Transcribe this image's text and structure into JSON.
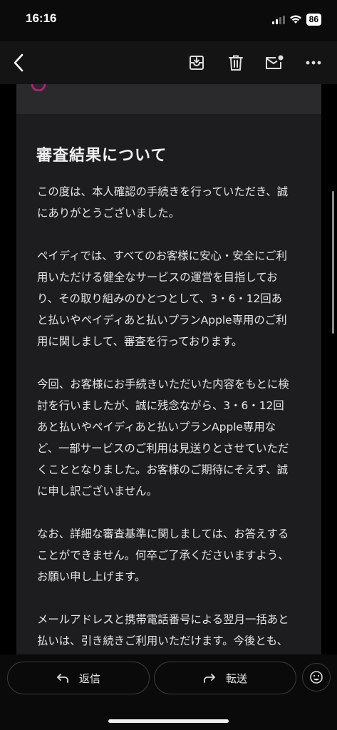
{
  "status": {
    "time": "16:16",
    "battery": "86"
  },
  "toolbar": {
    "back_icon": "chevron-left-icon",
    "archive_icon": "archive-icon",
    "trash_icon": "trash-icon",
    "mark_unread_icon": "mail-unread-icon",
    "more_icon": "more-horizontal-icon"
  },
  "email": {
    "title": "審査結果について",
    "paragraphs": [
      "この度は、本人確認の手続きを行っていただき、誠\nにありがとうございました。",
      "ペイディでは、すべてのお客様に安心・安全にご利\n用いただける健全なサービスの運営を目指してお\nり、その取り組みのひとつとして、3・6・12回あ\nと払いやペイディあと払いプランApple専用のご利\n用に関しまして、審査を行っております。",
      "今回、お客様にお手続きいただいた内容をもとに検\n討を行いましたが、誠に残念ながら、3・6・12回\nあと払いやペイディあと払いプランApple専用な\nど、一部サービスのご利用は見送りとさせていただ\nくこととなりました。お客様のご期待にそえず、誠\nに申し訳ございません。",
      "なお、詳細な審査基準に関しましては、お答えする\nことができません。何卒ご了承くださいますよう、\nお願い申し上げます。",
      "メールアドレスと携帯電話番号による翌月一括あと\n払いは、引き続きご利用いただけます。今後とも、\nペイディでのお買い物をお楽しみいただけますと幸\nいです。"
    ]
  },
  "actions": {
    "reply_label": "返信",
    "forward_label": "転送",
    "reply_icon": "reply-icon",
    "forward_icon": "forward-icon",
    "emoji_icon": "emoji-icon"
  }
}
